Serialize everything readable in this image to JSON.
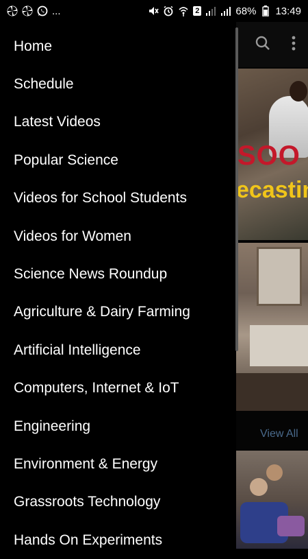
{
  "status_bar": {
    "left_icons": [
      "pinwheel-icon",
      "pinwheel-icon",
      "whatsapp-icon"
    ],
    "more": "...",
    "battery_percent": "68%",
    "sim_slot": "2",
    "time": "13:49"
  },
  "drawer": {
    "items": [
      {
        "label": "Home"
      },
      {
        "label": "Schedule"
      },
      {
        "label": "Latest Videos"
      },
      {
        "label": "Popular Science"
      },
      {
        "label": "Videos for School Students"
      },
      {
        "label": "Videos for Women"
      },
      {
        "label": "Science News Roundup"
      },
      {
        "label": "Agriculture & Dairy Farming"
      },
      {
        "label": "Artificial Intelligence"
      },
      {
        "label": "Computers, Internet & IoT"
      },
      {
        "label": "Engineering"
      },
      {
        "label": "Environment & Energy"
      },
      {
        "label": "Grassroots Technology"
      },
      {
        "label": "Hands On Experiments"
      }
    ]
  },
  "background": {
    "card1_text_red": "SOO",
    "card1_text_yellow": "ecastin",
    "view_all": "View All"
  },
  "colors": {
    "background": "#000000",
    "drawer_text": "#ffffff",
    "view_all": "#4a6a8c"
  }
}
